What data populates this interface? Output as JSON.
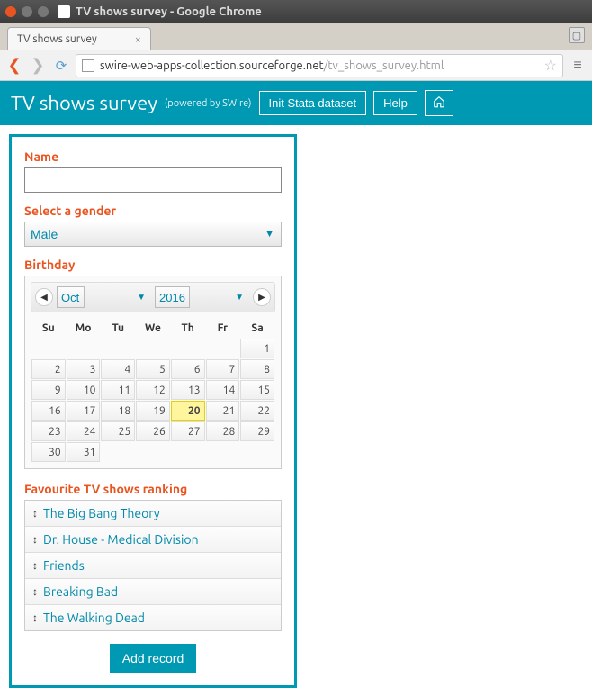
{
  "os": {
    "title": "TV shows survey - Google Chrome"
  },
  "tab": {
    "title": "TV shows survey"
  },
  "url": {
    "host": "swire-web-apps-collection.sourceforge.net",
    "path": "/tv_shows_survey.html"
  },
  "header": {
    "title": "TV shows survey",
    "powered": "(powered by SWire)",
    "init_btn": "Init Stata dataset",
    "help_btn": "Help"
  },
  "form": {
    "name_label": "Name",
    "name_value": "",
    "gender_label": "Select a gender",
    "gender_value": "Male",
    "birthday_label": "Birthday",
    "month": "Oct",
    "year": "2016",
    "dow": [
      "Su",
      "Mo",
      "Tu",
      "We",
      "Th",
      "Fr",
      "Sa"
    ],
    "weeks": [
      [
        "",
        "",
        "",
        "",
        "",
        "",
        1
      ],
      [
        2,
        3,
        4,
        5,
        6,
        7,
        8
      ],
      [
        9,
        10,
        11,
        12,
        13,
        14,
        15
      ],
      [
        16,
        17,
        18,
        19,
        20,
        21,
        22
      ],
      [
        23,
        24,
        25,
        26,
        27,
        28,
        29
      ],
      [
        30,
        31,
        "",
        "",
        "",
        "",
        ""
      ]
    ],
    "today": 20,
    "ranking_label": "Favourite TV shows ranking",
    "shows": [
      "The Big Bang Theory",
      "Dr. House - Medical Division",
      "Friends",
      "Breaking Bad",
      "The Walking Dead"
    ],
    "add_btn": "Add record"
  }
}
